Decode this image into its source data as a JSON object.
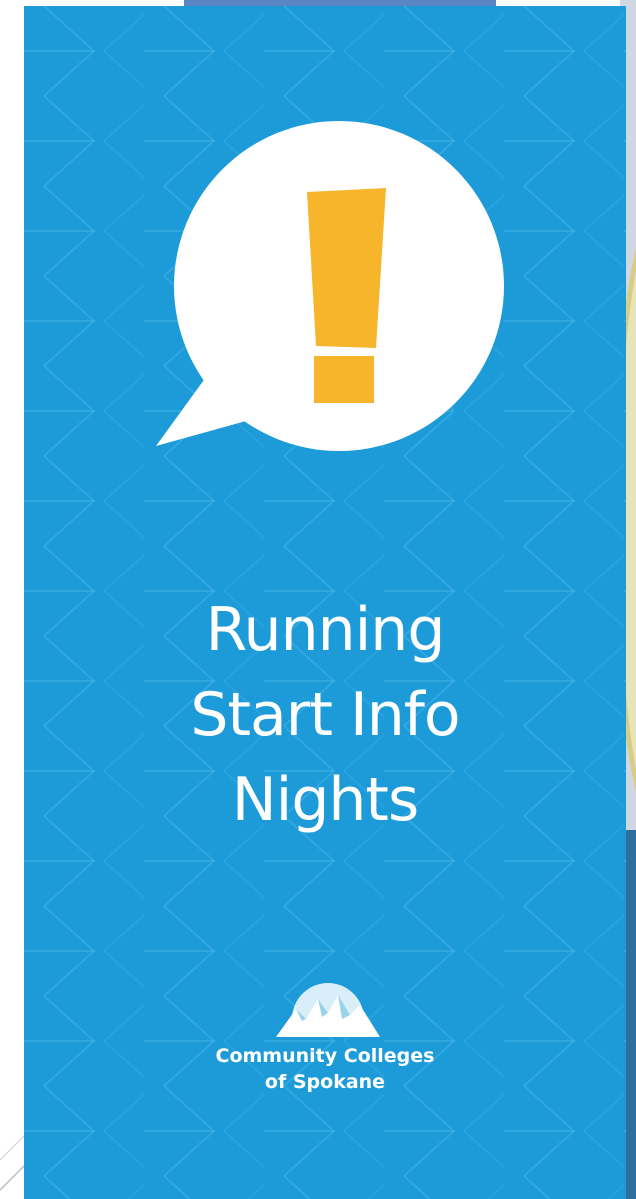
{
  "banner": {
    "headline_lines": [
      "Running",
      "Start Info",
      "Nights"
    ],
    "icon": "exclamation-speech-bubble-icon",
    "logo": {
      "icon": "mountain-sun-logo-icon",
      "lines": [
        "Community Colleges",
        "of Spokane"
      ]
    }
  },
  "colors": {
    "banner_blue": "#1c9bd8",
    "exclamation_yellow": "#f6b52a",
    "bubble_white": "#ffffff",
    "text_white": "#ffffff"
  }
}
